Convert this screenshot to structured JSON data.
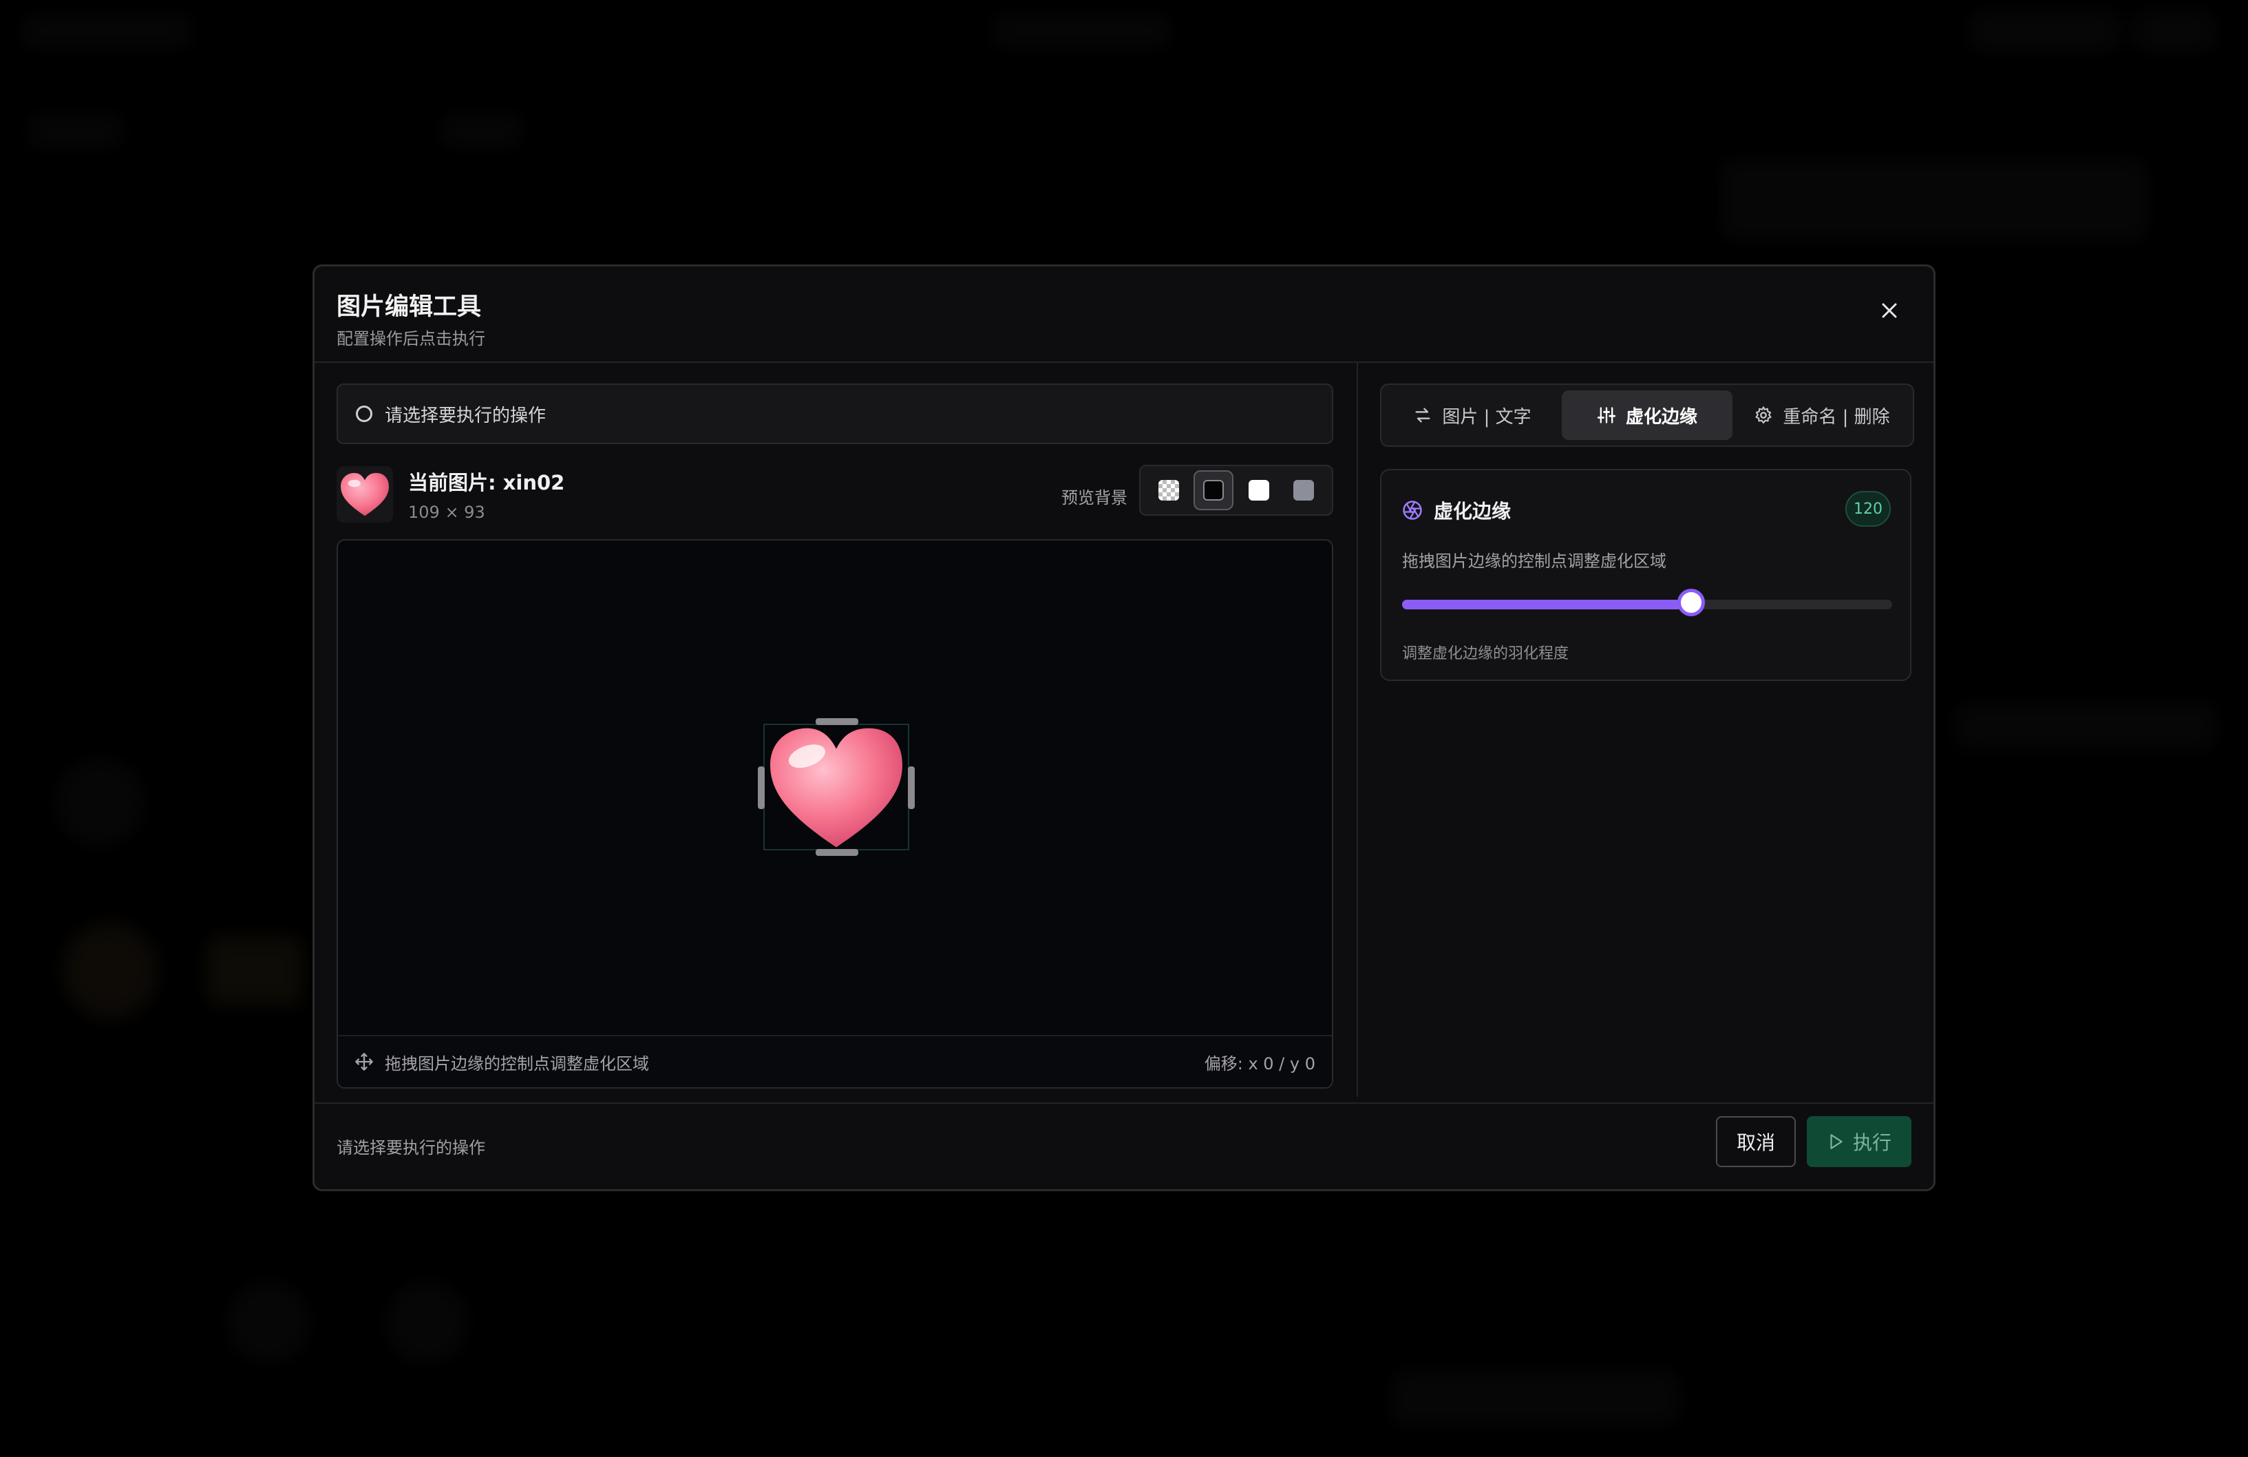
{
  "dialog": {
    "title": "图片编辑工具",
    "subtitle": "配置操作后点击执行"
  },
  "operation_select": {
    "placeholder": "请选择要执行的操作"
  },
  "current_image": {
    "label": "当前图片: xin02",
    "dimensions": "109 × 93"
  },
  "preview_bg": {
    "label": "预览背景",
    "options": [
      "checker",
      "black",
      "white",
      "gray"
    ],
    "selected": "black"
  },
  "preview": {
    "hint": "拖拽图片边缘的控制点调整虚化区域",
    "offset": "偏移:  x 0 / y 0"
  },
  "tabs": [
    {
      "label": "图片 | 文字",
      "icon": "swap-icon",
      "active": false
    },
    {
      "label": "虚化边缘",
      "icon": "sliders-icon",
      "active": true
    },
    {
      "label": "重命名 | 删除",
      "icon": "gear-icon",
      "active": false
    }
  ],
  "blur_card": {
    "title": "虚化边缘",
    "value": "120",
    "description": "拖拽图片边缘的控制点调整虚化区域",
    "slider_fraction": 0.59,
    "hint": "调整虚化边缘的羽化程度"
  },
  "footer": {
    "status": "请选择要执行的操作",
    "cancel": "取消",
    "execute": "执行"
  },
  "colors": {
    "accent_purple": "#8b5cf6",
    "badge_green": "#5fd3a5",
    "execute_bg": "#0f4a35"
  }
}
